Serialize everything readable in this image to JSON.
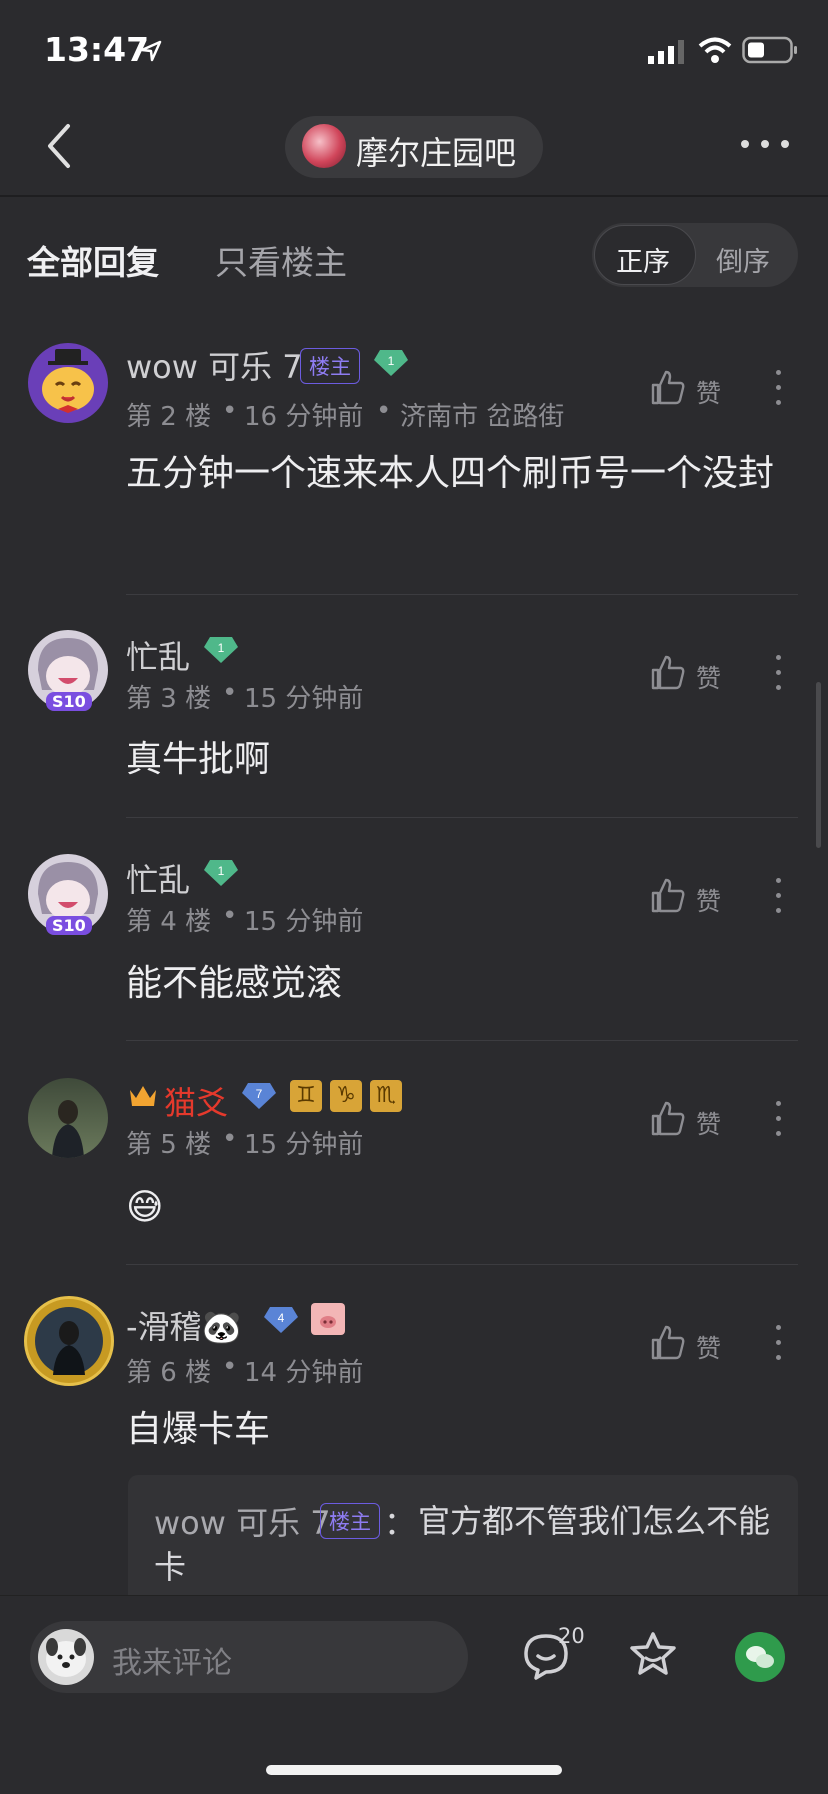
{
  "status": {
    "time": "13:47"
  },
  "forum": {
    "name": "摩尔庄园吧"
  },
  "tabs": {
    "all": "全部回复",
    "op_only": "只看楼主",
    "asc": "正序",
    "desc": "倒序"
  },
  "like_label": "赞",
  "op_badge": "楼主",
  "posts": [
    {
      "user": "wow 可乐 7",
      "level": "1",
      "floor": "第 2 楼",
      "time": "16 分钟前",
      "location": "济南市 岔路街",
      "content": "五分钟一个速来本人四个刷币号一个没封"
    },
    {
      "user": "忙乱",
      "level": "1",
      "floor": "第 3 楼",
      "time": "15 分钟前",
      "content": "真牛批啊",
      "avatar_tag": "S10"
    },
    {
      "user": "忙乱",
      "level": "1",
      "floor": "第 4 楼",
      "time": "15 分钟前",
      "content": "能不能感觉滚",
      "avatar_tag": "S10"
    },
    {
      "user": "猫爻",
      "level": "7",
      "floor": "第 5 楼",
      "time": "15 分钟前",
      "content": "😅",
      "zodiac": [
        "♊",
        "♑",
        "♏"
      ]
    },
    {
      "user": "-滑稽🐼",
      "level": "4",
      "floor": "第 6 楼",
      "time": "14 分钟前",
      "content": "自爆卡车"
    }
  ],
  "reply": {
    "user": "wow 可乐 7",
    "sep": "：",
    "text": "官方都不管我们怎么不能卡"
  },
  "bottom": {
    "placeholder": "我来评论",
    "comment_count": "20"
  },
  "colors": {
    "bg": "#2b2b2e",
    "accent_red": "#e5392c",
    "gem_green": "#4fb88a",
    "gem_blue": "#5a84d6",
    "op_purple": "#6c5ce0"
  }
}
